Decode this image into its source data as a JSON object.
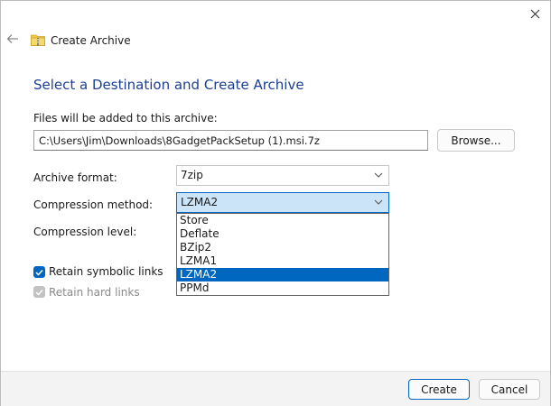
{
  "window": {
    "title": "Create Archive"
  },
  "heading": "Select a Destination and Create Archive",
  "destination": {
    "label": "Files will be added to this archive:",
    "path": "C:\\Users\\Jim\\Downloads\\8GadgetPackSetup (1).msi.7z",
    "browse_label": "Browse..."
  },
  "format": {
    "label": "Archive format:",
    "value": "7zip"
  },
  "method": {
    "label": "Compression method:",
    "value": "LZMA2",
    "options": [
      "Store",
      "Deflate",
      "BZip2",
      "LZMA1",
      "LZMA2",
      "PPMd"
    ],
    "highlighted": "LZMA2"
  },
  "level": {
    "label": "Compression level:"
  },
  "options": {
    "symbolic_links": {
      "label": "Retain symbolic links",
      "checked": true
    },
    "hard_links": {
      "label": "Retain hard links",
      "checked": true,
      "disabled": true
    }
  },
  "footer": {
    "create_label": "Create",
    "cancel_label": "Cancel"
  },
  "icons": {
    "close": "close-icon",
    "back": "back-arrow-icon",
    "header": "zip-folder-icon",
    "chevron": "chevron-down-icon",
    "check": "checkmark-icon"
  },
  "colors": {
    "accent": "#0067c0",
    "heading": "#1c3f94",
    "footer": "#f3f3f3"
  }
}
